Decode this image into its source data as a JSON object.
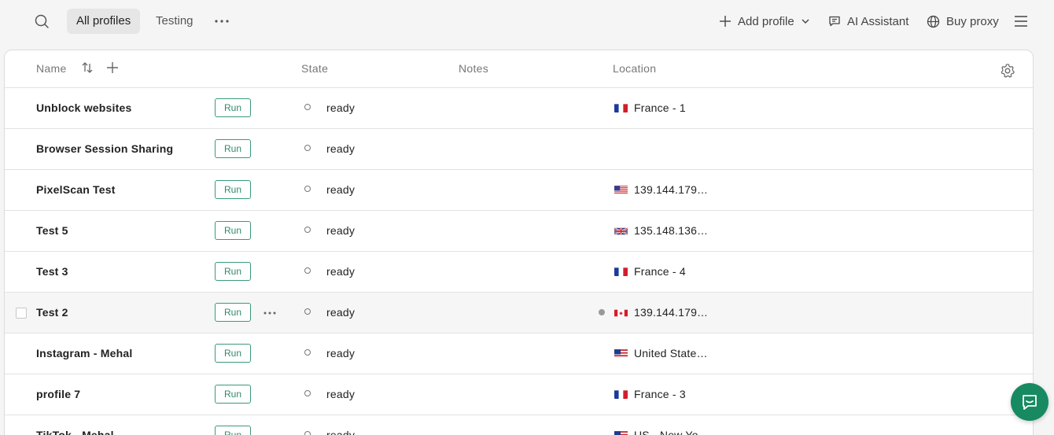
{
  "topbar": {
    "tabs": [
      {
        "label": "All profiles",
        "active": true
      },
      {
        "label": "Testing",
        "active": false
      }
    ],
    "add_profile_label": "Add profile",
    "ai_assistant_label": "AI Assistant",
    "buy_proxy_label": "Buy proxy"
  },
  "table": {
    "columns": {
      "name": "Name",
      "state": "State",
      "notes": "Notes",
      "location": "Location"
    },
    "run_label": "Run",
    "rows": [
      {
        "name": "Unblock websites",
        "state": "ready",
        "notes": "",
        "flag": "fr",
        "location": "France - 1"
      },
      {
        "name": "Browser Session Sharing",
        "state": "ready",
        "notes": "",
        "flag": "",
        "location": ""
      },
      {
        "name": "PixelScan Test",
        "state": "ready",
        "notes": "",
        "flag": "us",
        "location": "139.144.179…"
      },
      {
        "name": "Test 5",
        "state": "ready",
        "notes": "",
        "flag": "gb",
        "location": "135.148.136…"
      },
      {
        "name": "Test 3",
        "state": "ready",
        "notes": "",
        "flag": "fr",
        "location": "France - 4"
      },
      {
        "name": "Test 2",
        "state": "ready",
        "notes": "",
        "flag": "ca",
        "location": "139.144.179…",
        "hover": true
      },
      {
        "name": "Instagram - Mehal",
        "state": "ready",
        "notes": "",
        "flag": "us-partial",
        "location": "United State…"
      },
      {
        "name": "profile 7",
        "state": "ready",
        "notes": "",
        "flag": "fr",
        "location": "France - 3"
      },
      {
        "name": "TikTok - Mehal",
        "state": "ready",
        "notes": "",
        "flag": "us-partial",
        "location": "US - New Yo…"
      }
    ]
  },
  "colors": {
    "accent": "#178a62",
    "run_border": "#3a9a7a",
    "background": "#f5f5f5"
  },
  "icons": [
    "search-icon",
    "more-horizontal-icon",
    "plus-icon",
    "chevron-down-icon",
    "chat-icon",
    "globe-icon",
    "menu-icon",
    "sort-icon",
    "gear-icon",
    "chat-bubble-icon"
  ]
}
